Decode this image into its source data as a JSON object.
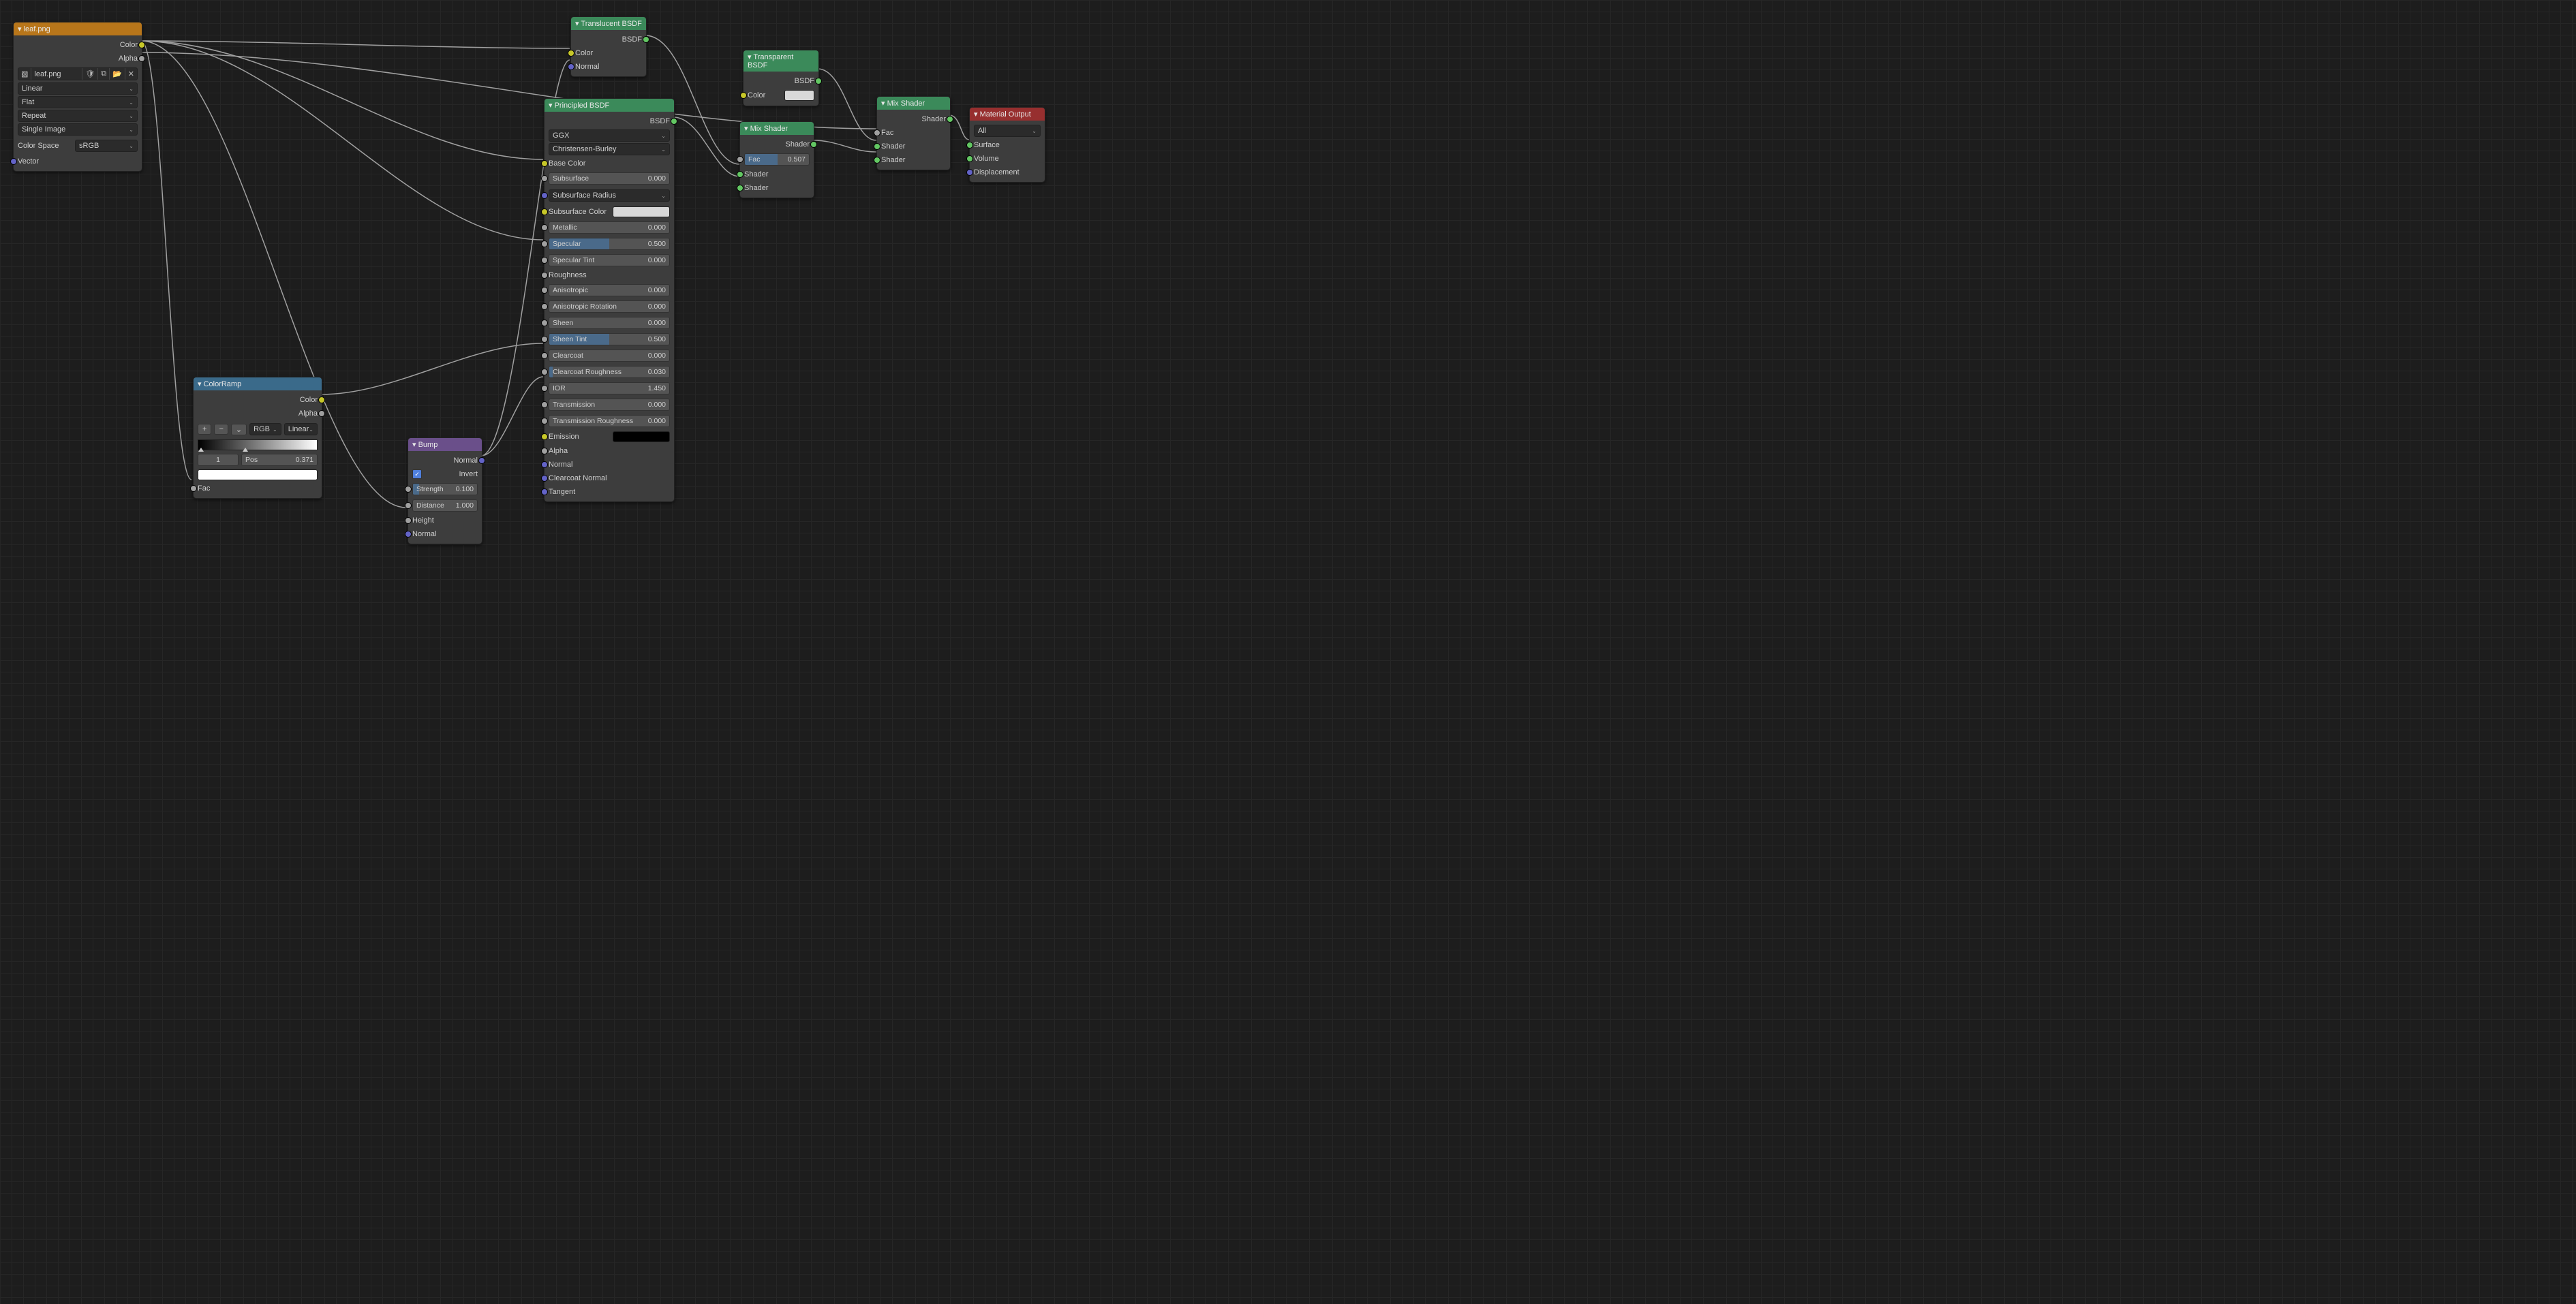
{
  "imageTexture": {
    "title": "leaf.png",
    "out_color": "Color",
    "out_alpha": "Alpha",
    "filename": "leaf.png",
    "interp": "Linear",
    "projection": "Flat",
    "extension": "Repeat",
    "source": "Single Image",
    "color_space_label": "Color Space",
    "color_space": "sRGB",
    "in_vector": "Vector"
  },
  "principled": {
    "title": "Principled BSDF",
    "out_bsdf": "BSDF",
    "distribution": "GGX",
    "subsurface_method": "Christensen-Burley",
    "base_color": "Base Color",
    "subsurface_label": "Subsurface",
    "subsurface_val": "0.000",
    "subsurface_radius": "Subsurface Radius",
    "subsurface_color": "Subsurface Color",
    "metallic_label": "Metallic",
    "metallic_val": "0.000",
    "specular_label": "Specular",
    "specular_val": "0.500",
    "specular_tint_label": "Specular Tint",
    "specular_tint_val": "0.000",
    "roughness": "Roughness",
    "aniso_label": "Anisotropic",
    "aniso_val": "0.000",
    "aniso_rot_label": "Anisotropic Rotation",
    "aniso_rot_val": "0.000",
    "sheen_label": "Sheen",
    "sheen_val": "0.000",
    "sheen_tint_label": "Sheen Tint",
    "sheen_tint_val": "0.500",
    "clearcoat_label": "Clearcoat",
    "clearcoat_val": "0.000",
    "clearcoat_rough_label": "Clearcoat Roughness",
    "clearcoat_rough_val": "0.030",
    "ior_label": "IOR",
    "ior_val": "1.450",
    "transmission_label": "Transmission",
    "transmission_val": "0.000",
    "transmission_rough_label": "Transmission Roughness",
    "transmission_rough_val": "0.000",
    "emission": "Emission",
    "alpha": "Alpha",
    "normal": "Normal",
    "clearcoat_normal": "Clearcoat Normal",
    "tangent": "Tangent"
  },
  "translucent": {
    "title": "Translucent BSDF",
    "out_bsdf": "BSDF",
    "in_color": "Color",
    "in_normal": "Normal"
  },
  "transparent": {
    "title": "Transparent BSDF",
    "out_bsdf": "BSDF",
    "in_color": "Color"
  },
  "mixShader1": {
    "title": "Mix Shader",
    "out_shader": "Shader",
    "fac_label": "Fac",
    "fac_val": "0.507",
    "in_shader": "Shader"
  },
  "mixShader2": {
    "title": "Mix Shader",
    "out_shader": "Shader",
    "fac": "Fac",
    "in_shader": "Shader"
  },
  "materialOutput": {
    "title": "Material Output",
    "target": "All",
    "surface": "Surface",
    "volume": "Volume",
    "displacement": "Displacement"
  },
  "colorRamp": {
    "title": "ColorRamp",
    "out_color": "Color",
    "out_alpha": "Alpha",
    "rgb": "RGB",
    "linear": "Linear",
    "index": "1",
    "pos_label": "Pos",
    "pos_val": "0.371",
    "fac": "Fac"
  },
  "bump": {
    "title": "Bump",
    "out_normal": "Normal",
    "invert": "Invert",
    "strength_label": "Strength",
    "strength_val": "0.100",
    "distance_label": "Distance",
    "distance_val": "1.000",
    "height": "Height",
    "normal": "Normal"
  }
}
